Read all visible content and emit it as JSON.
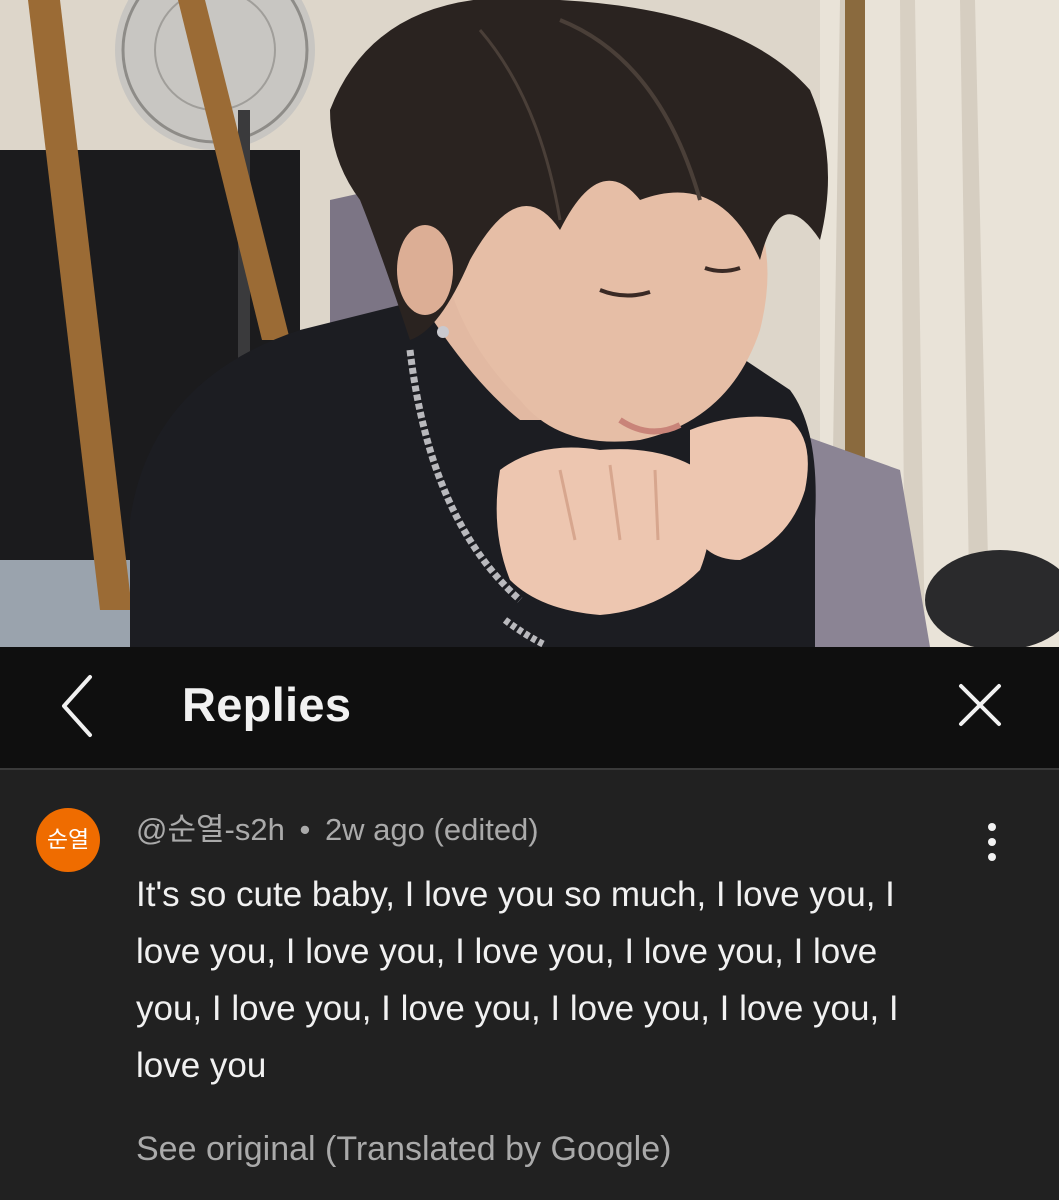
{
  "header": {
    "title": "Replies",
    "back_icon": "chevron-left-icon",
    "close_icon": "close-icon"
  },
  "comment": {
    "avatar_text": "순열",
    "author": "@순열-s2h",
    "separator": "•",
    "time": "2w ago (edited)",
    "text": "It's so cute baby, I love you so much, I love you, I love you, I love you, I love you, I love you, I love you, I love you, I love you, I love you, I love you, I love you",
    "see_original": "See original (Translated by Google)",
    "more_icon": "more-vertical-icon"
  },
  "colors": {
    "header_bg": "#0f0f0f",
    "comment_bg": "#212121",
    "avatar_bg": "#ef6c00",
    "primary_text": "#f1f1f1",
    "secondary_text": "#aaaaaa"
  }
}
